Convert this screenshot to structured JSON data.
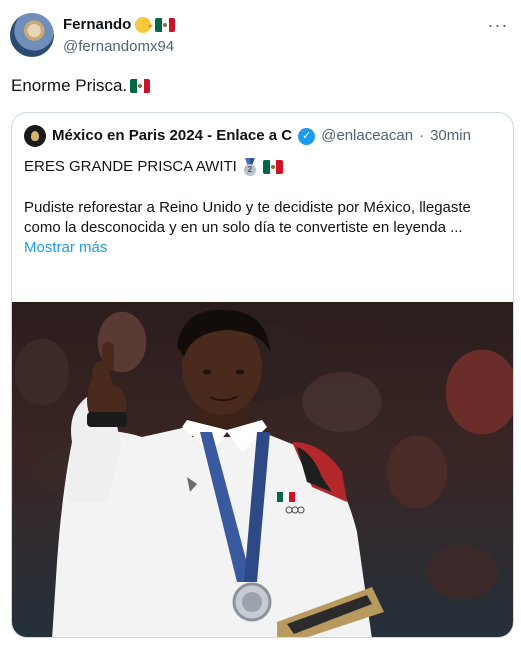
{
  "tweet": {
    "author_name": "Fernando",
    "author_handle": "@fernandomx94",
    "text": "Enorme Prisca.",
    "more_icon": "more-dots-icon"
  },
  "quoted": {
    "name": "México en Paris 2024 - Enlace a C",
    "handle": "@enlaceacan",
    "separator": "·",
    "time": "30min",
    "headline": "ERES GRANDE PRISCA AWITI",
    "body": "Pudiste reforestar a Reino Unido y te decidiste por México, llegaste como la desconocida y en un solo día te convertiste en leyenda ...",
    "show_more": "Mostrar más"
  },
  "colors": {
    "accent": "#1d9bf0",
    "secondary_text": "#536471",
    "border": "#cfd9de"
  }
}
